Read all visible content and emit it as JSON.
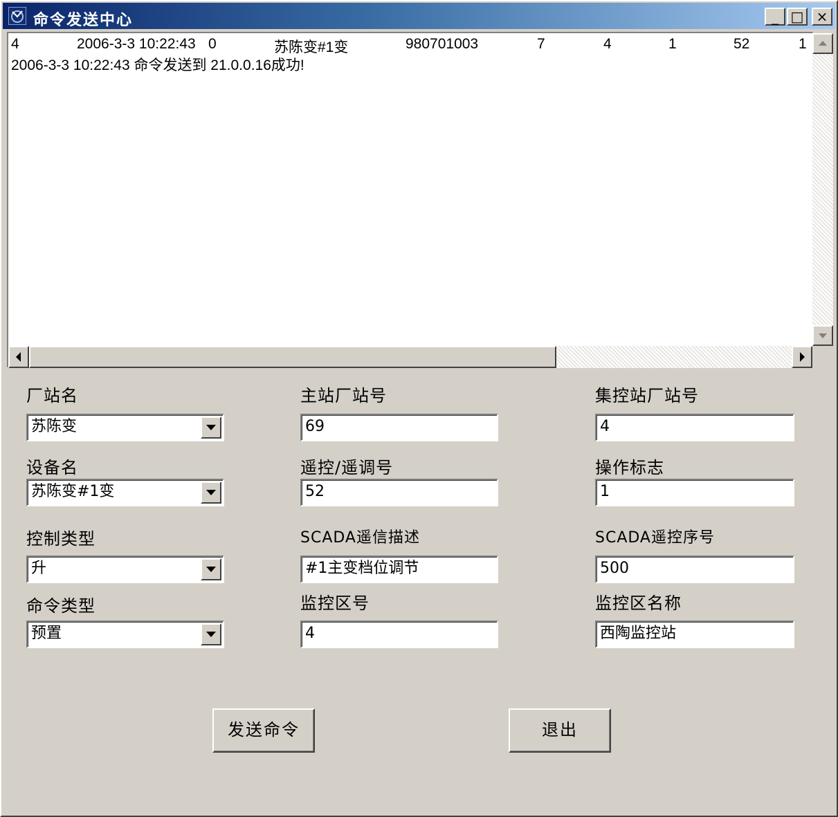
{
  "window": {
    "title": "命令发送中心",
    "minimize_label": "_",
    "maximize_label": "□",
    "close_label": "×"
  },
  "log": {
    "row": [
      "4",
      "2006-3-3 10:22:43",
      "0",
      "苏陈变#1变",
      "980701003",
      "7",
      "4",
      "1",
      "52",
      "1"
    ],
    "message": "2006-3-3 10:22:43  命令发送到 21.0.0.16成功!"
  },
  "form": {
    "station_name": {
      "label": "厂站名",
      "value": "苏陈变"
    },
    "master_station_no": {
      "label": "主站厂站号",
      "value": "69"
    },
    "control_station_no": {
      "label": "集控站厂站号",
      "value": "4"
    },
    "device_name": {
      "label": "设备名",
      "value": "苏陈变#1变"
    },
    "remote_no": {
      "label": "遥控/遥调号",
      "value": "52"
    },
    "operation_flag": {
      "label": "操作标志",
      "value": "1"
    },
    "control_type": {
      "label": "控制类型",
      "value": "升"
    },
    "scada_signal_desc": {
      "label": "SCADA遥信描述",
      "value": "#1主变档位调节"
    },
    "scada_control_seq": {
      "label": "SCADA遥控序号",
      "value": "500"
    },
    "command_type": {
      "label": "命令类型",
      "value": "预置"
    },
    "monitor_zone_no": {
      "label": "监控区号",
      "value": "4"
    },
    "monitor_zone_name": {
      "label": "监控区名称",
      "value": "西陶监控站"
    }
  },
  "buttons": {
    "send": "发送命令",
    "exit": "退出"
  },
  "icons": {
    "app": "app-icon",
    "combo_arrow": "chevron-down-icon"
  }
}
